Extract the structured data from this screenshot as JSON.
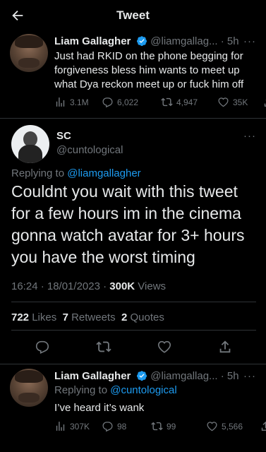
{
  "header": {
    "title": "Tweet"
  },
  "tweet1": {
    "name": "Liam Gallagher",
    "handle_time": "@liamgallag... · 5h",
    "text": "Just had RKID on the phone begging for forgiveness bless him wants to meet up what Dya reckon meet up or fuck him off",
    "views": "3.1M",
    "replies": "6,022",
    "retweets": "4,947",
    "likes": "35K"
  },
  "tweet2": {
    "name": "SC",
    "handle": "@cuntological",
    "replying_prefix": "Replying to ",
    "replying_to": "@liamgallagher",
    "text": "Couldnt you wait with this tweet for a few hours im in the cinema gonna watch avatar for 3+ hours you have the worst timing",
    "timestamp": "16:24 · 18/01/2023 · ",
    "views_count": "300K",
    "views_label": " Views",
    "likes_count": "722",
    "likes_label": " Likes",
    "retweets_count": "7",
    "retweets_label": " Retweets",
    "quotes_count": "2",
    "quotes_label": " Quotes"
  },
  "tweet3": {
    "name": "Liam Gallagher",
    "handle_time": "@liamgallag... · 5h",
    "replying_prefix": "Replying to ",
    "replying_to": "@cuntological",
    "text": "I’ve heard it’s wank",
    "views": "307K",
    "replies": "98",
    "retweets": "99",
    "likes": "5,566"
  },
  "icons": {
    "more": "···"
  },
  "colors": {
    "accent": "#1d9bf0",
    "muted": "#71767b",
    "text": "#e7e9ea",
    "divider": "#2f3336"
  }
}
